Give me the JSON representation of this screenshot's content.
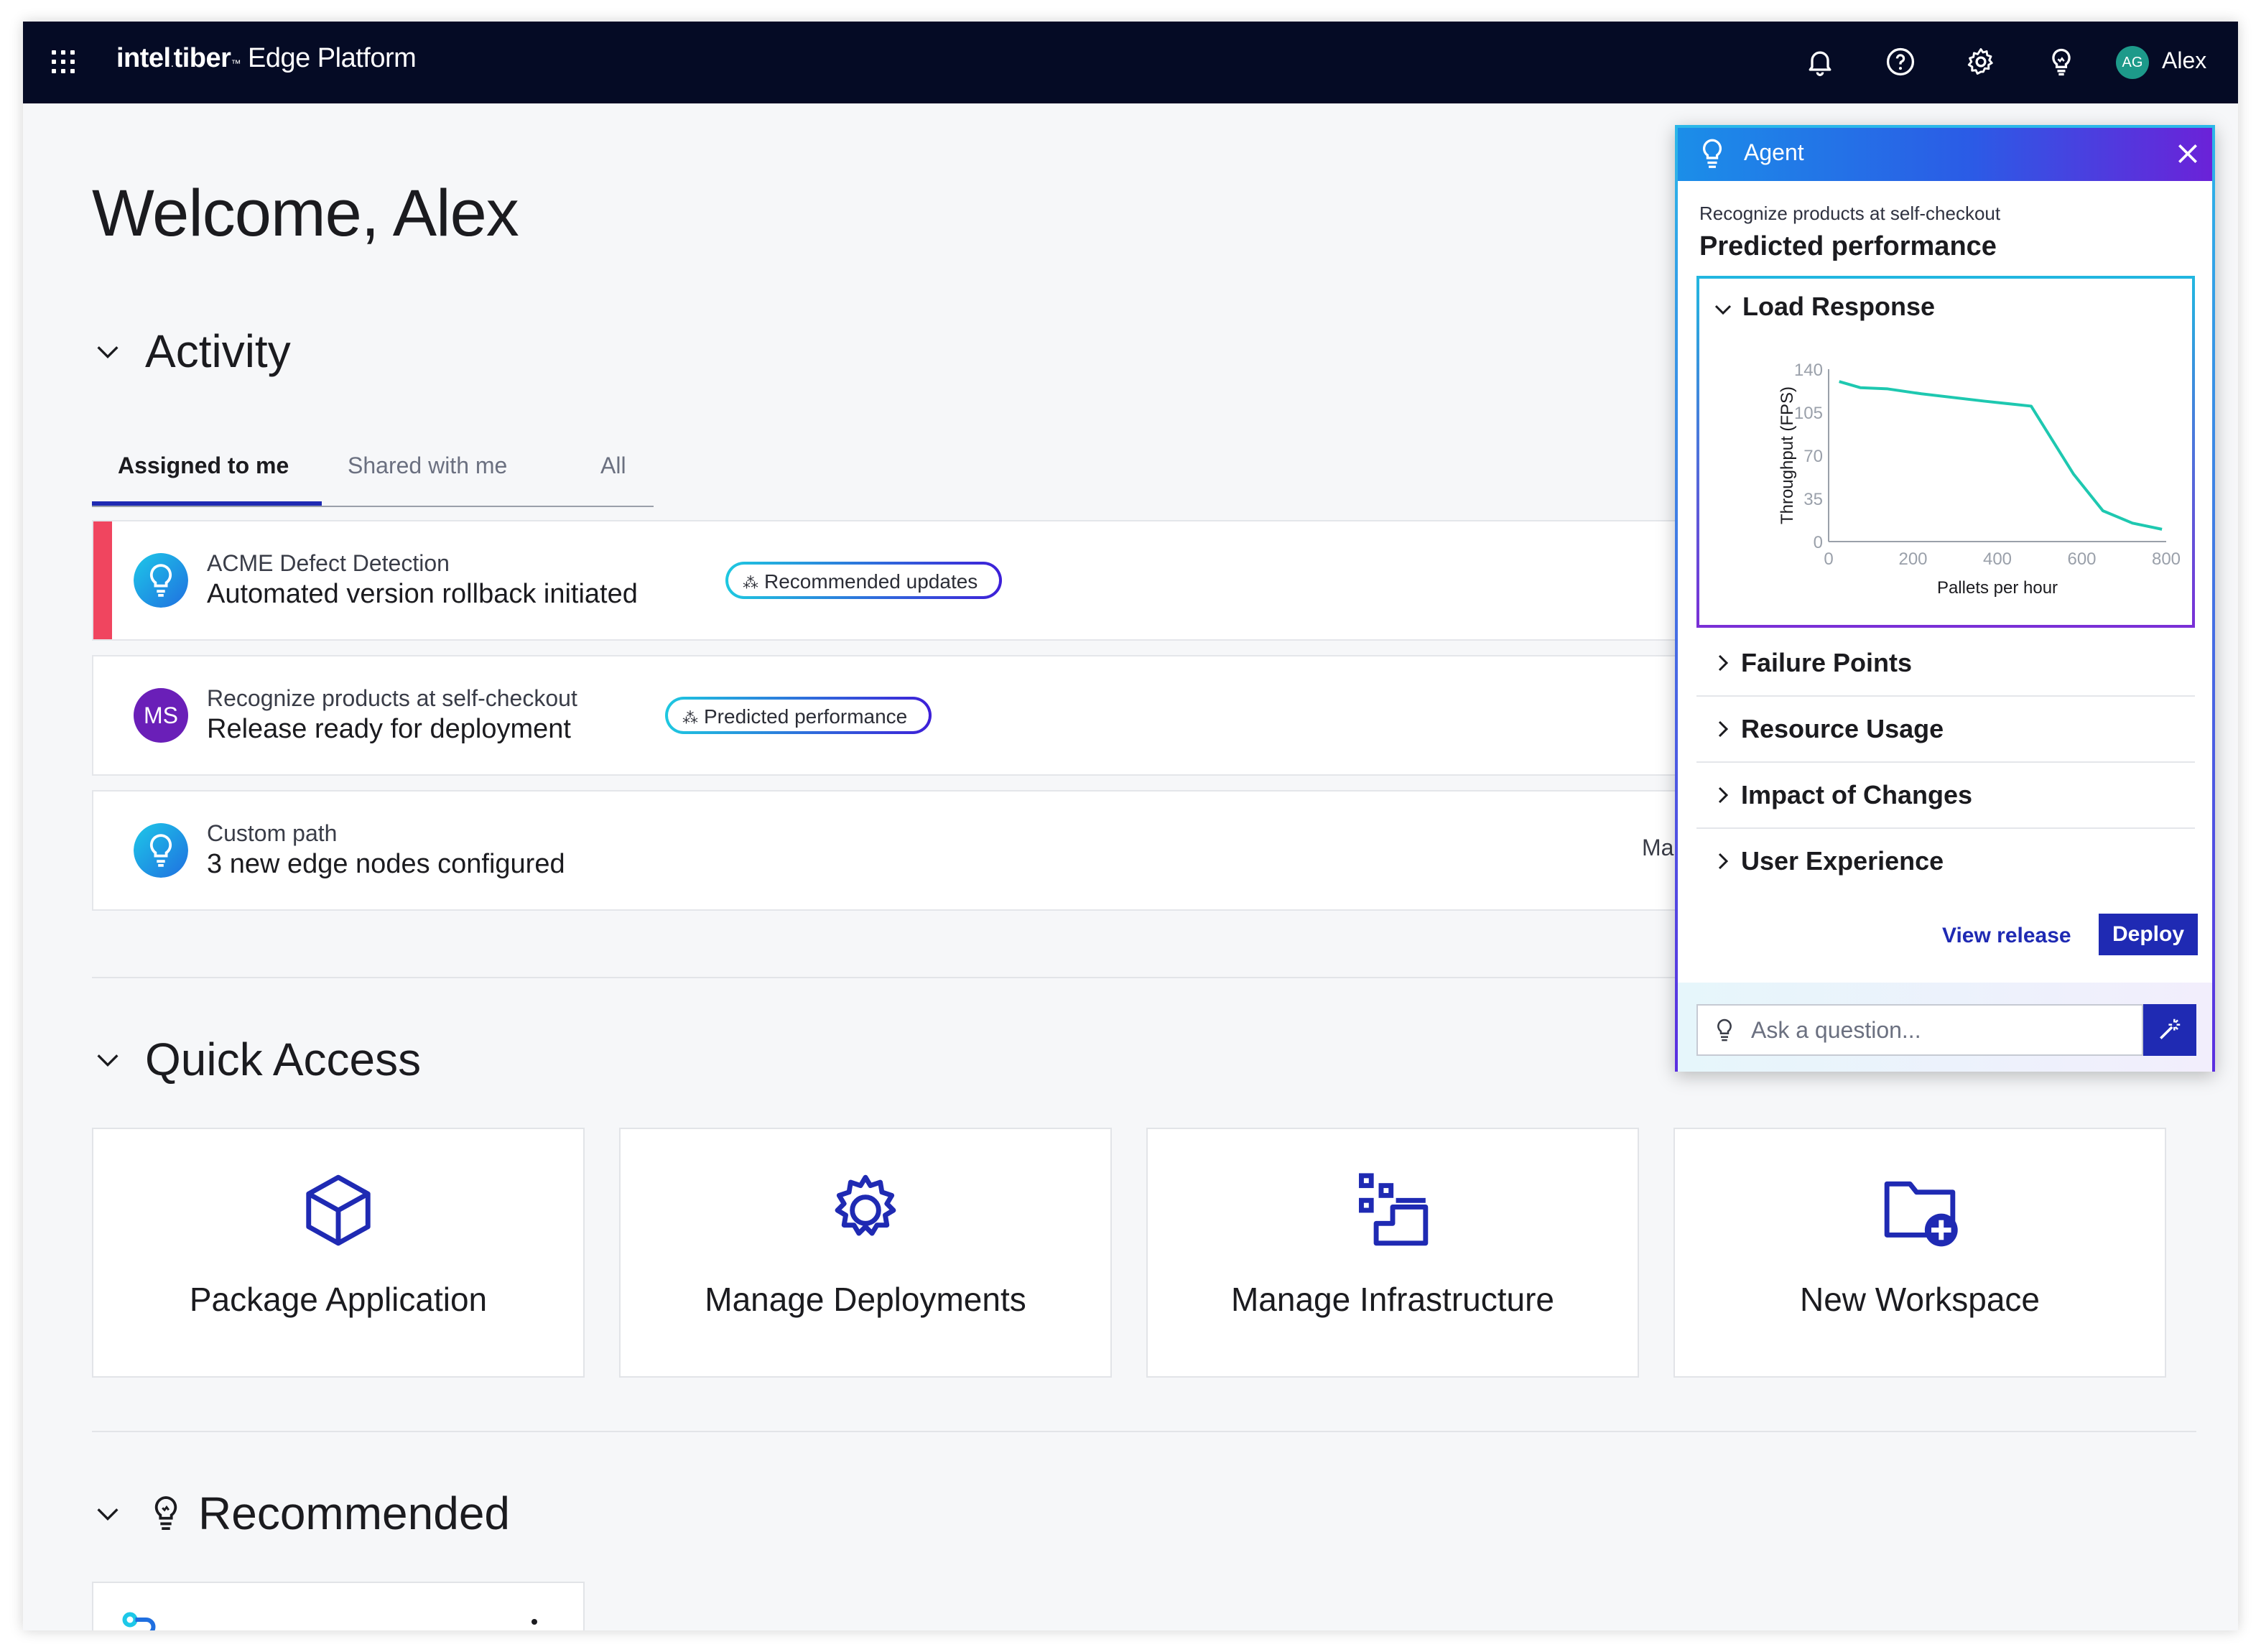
{
  "topbar": {
    "brand_intel": "intel",
    "brand_tiber": "tiber",
    "product": "Edge Platform",
    "avatar_initials": "AG",
    "user_name": "Alex"
  },
  "welcome": "Welcome, Alex",
  "activity": {
    "title": "Activity",
    "tabs": [
      "Assigned to me",
      "Shared with me",
      "All"
    ],
    "rows": [
      {
        "subtitle": "ACME  Defect Detection",
        "main": "Automated version rollback initiated",
        "pill": "Recommended updates"
      },
      {
        "avatar": "MS",
        "subtitle": "Recognize products at self-checkout",
        "main": "Release ready for deployment",
        "pill": "Predicted performance"
      },
      {
        "subtitle": "Custom path",
        "main": "3 new edge nodes configured",
        "trunc": "Ma"
      }
    ]
  },
  "quick_access": {
    "title": "Quick Access",
    "cards": [
      "Package Application",
      "Manage Deployments",
      "Manage Infrastructure",
      "New Workspace"
    ]
  },
  "recommended": {
    "title": "Recommended"
  },
  "agent": {
    "title": "Agent",
    "subtitle": "Recognize products at self-checkout",
    "heading": "Predicted performance",
    "load_response_title": "Load Response",
    "sections": [
      "Failure Points",
      "Resource Usage",
      "Impact of Changes",
      "User Experience"
    ],
    "view_release": "View release",
    "deploy": "Deploy",
    "ask_placeholder": "Ask a question..."
  },
  "chart_data": {
    "type": "line",
    "xlabel": "Pallets per hour",
    "ylabel": "Throughput (FPS)",
    "xlim": [
      0,
      800
    ],
    "ylim": [
      0,
      140
    ],
    "x_ticks": [
      "0",
      "200",
      "400",
      "600",
      "800"
    ],
    "y_ticks": [
      "0",
      "35",
      "70",
      "105",
      "140"
    ],
    "series": [
      {
        "x": [
          25,
          75,
          140,
          220,
          370,
          480,
          580,
          650,
          720,
          790
        ],
        "values": [
          130,
          125,
          124,
          120,
          114,
          110,
          55,
          25,
          15,
          10
        ]
      }
    ]
  },
  "colors": {
    "accent": "#1f2ab3",
    "topbar": "#050b25",
    "alert": "#f0455f",
    "line": "#1ec8b0"
  }
}
